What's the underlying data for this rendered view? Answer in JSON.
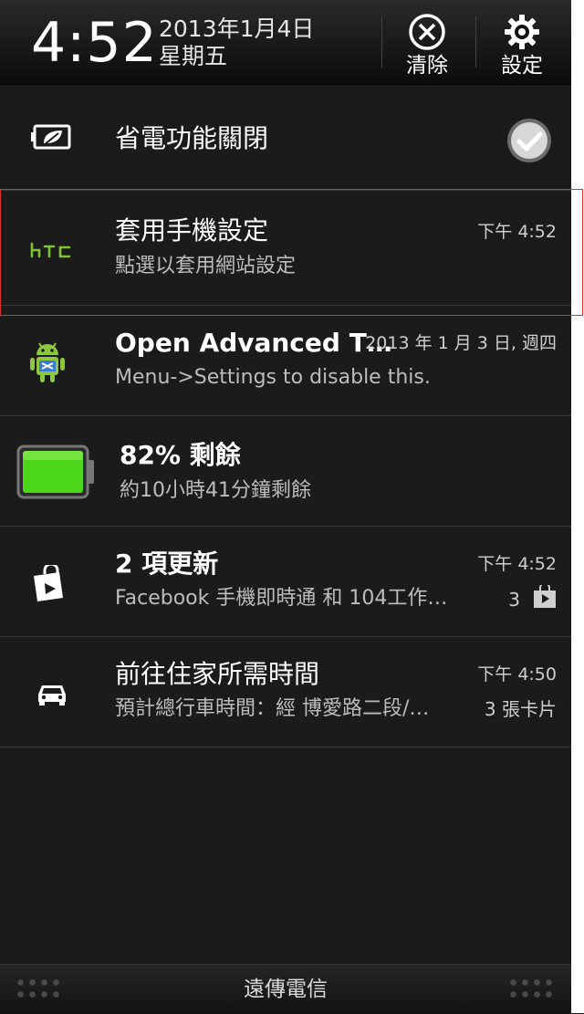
{
  "header": {
    "time": "4:52",
    "date": "2013年1月4日",
    "weekday": "星期五",
    "clear_label": "清除",
    "settings_label": "設定"
  },
  "power_saver": {
    "label": "省電功能關閉"
  },
  "notifications": [
    {
      "app": "htc",
      "title": "套用手機設定",
      "subtitle": "點選以套用網站設定",
      "time": "下午 4:52"
    },
    {
      "app": "android",
      "title": "Open Advanced T…",
      "subtitle": "Menu->Settings to disable this.",
      "time": "2013 年 1 月 3 日, 週四"
    },
    {
      "app": "battery",
      "title": "82% 剩餘",
      "subtitle": "約10小時41分鐘剩餘",
      "level": 0.82
    },
    {
      "app": "play-store",
      "title": "2 項更新",
      "subtitle": "Facebook 手機即時通 和 104工作…",
      "time": "下午 4:52",
      "count": "3"
    },
    {
      "app": "car",
      "title": "前往住家所需時間",
      "subtitle": "預計總行車時間：經 博愛路二段/…",
      "time": "下午 4:50",
      "count": "3 張卡片"
    }
  ],
  "footer": {
    "carrier": "遠傳電信"
  },
  "colors": {
    "background": "#1b1b1b",
    "htc_green": "#7ec52f",
    "battery_green": "#4cd61a",
    "highlight_red": "#e0302e"
  },
  "icons": [
    "clear-icon",
    "gear-icon",
    "battery-saver-icon",
    "toggle-check-icon",
    "htc-logo-icon",
    "android-icon",
    "battery-icon",
    "store-bag-icon",
    "play-icon",
    "car-icon"
  ]
}
